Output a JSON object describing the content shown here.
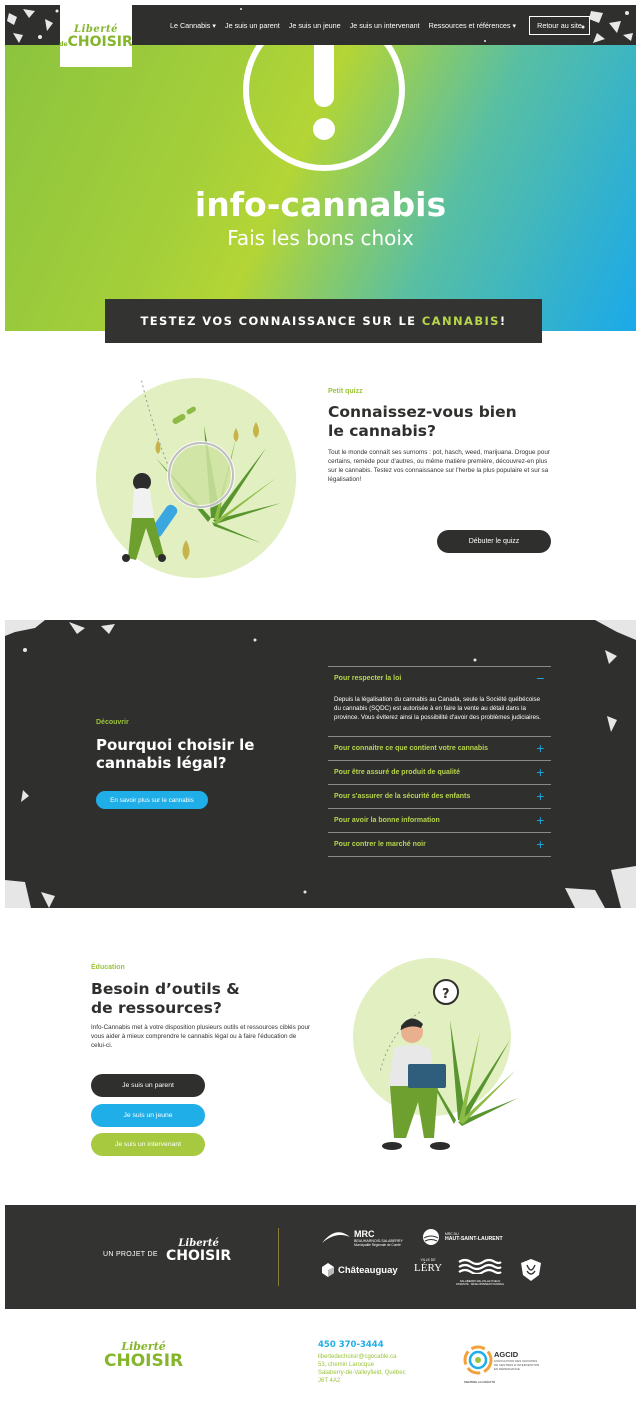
{
  "header": {
    "logo_top": "Liberté",
    "logo_bottom": "CHOISIR",
    "logo_de": "de",
    "nav": [
      {
        "label": "Le Cannabis",
        "has_dropdown": true
      },
      {
        "label": "Je suis un parent",
        "has_dropdown": false
      },
      {
        "label": "Je suis un jeune",
        "has_dropdown": false
      },
      {
        "label": "Je suis un intervenant",
        "has_dropdown": false
      },
      {
        "label": "Ressources et références",
        "has_dropdown": true
      }
    ],
    "dropdown_glyph": "▾",
    "back_button": "Retour au site"
  },
  "hero": {
    "title": "info-cannabis",
    "subtitle": "Fais les bons choix",
    "banner_prefix": "TESTEZ VOS CONNAISSANCE SUR LE ",
    "banner_highlight": "CANNABIS",
    "banner_suffix": "!"
  },
  "quiz": {
    "kicker": "Petit quizz",
    "title_line1": "Connaissez-vous bien",
    "title_line2": "le cannabis?",
    "body": "Tout le monde connaît ses surnoms : pot, hasch, weed, marijuana. Drogue pour certains, remède pour d'autres, ou même matière première, découvrez-en plus sur le cannabis. Testez vos connaissance sur l'herbe la plus populaire et sur sa légalisation!",
    "button": "Débuter le quizz"
  },
  "legal": {
    "kicker": "Découvrir",
    "title_line1": "Pourquoi choisir le",
    "title_line2": "cannabis légal?",
    "button": "En savoir plus sur le cannabis",
    "accordion": [
      {
        "label": "Pour respecter la loi",
        "sign": "−",
        "body": "Depuis la légalisation du cannabis au Canada, seule la Société québécoise du cannabis (SQDC) est autorisée à en faire la vente au détail dans la province. Vous éviterez ainsi la possibilité d'avoir des problèmes judiciaires."
      },
      {
        "label": "Pour connaitre ce que contient votre cannabis",
        "sign": "+"
      },
      {
        "label": "Pour être assuré de produit de qualité",
        "sign": "+"
      },
      {
        "label": "Pour s'assurer de la sécurité des enfants",
        "sign": "+"
      },
      {
        "label": "Pour avoir la bonne information",
        "sign": "+"
      },
      {
        "label": "Pour contrer le marché noir",
        "sign": "+"
      }
    ]
  },
  "education": {
    "kicker": "Éducation",
    "title_line1": "Besoin d’outils &",
    "title_line2": "de ressources?",
    "body": "Info-Cannabis met à votre disposition plusieurs outils et ressources ciblés pour vous aider à mieux comprendre le cannabis légal ou à faire l'éducation de celui-ci.",
    "buttons": [
      "Je suis un parent",
      "Je suis un jeune",
      "Je suis un intervenant"
    ]
  },
  "partners": {
    "project_label": "UN PROJET DE",
    "logos": {
      "mrc": "MRC",
      "mrc_sub": "BEAUHARNOIS-SALABERRY",
      "mrc_sub2": "Municipalité Régionale de Comté",
      "hsl_top": "MRC DU",
      "hsl": "HAUT-SAINT-LAURENT",
      "chateauguay": "Châteauguay",
      "lery_top": "VILLE DE",
      "lery": "LÉRY",
      "valleyfield": "SALABERRY-DE-VALLEYFIELD",
      "valleyfield_sub": "DIVERSITÉ · DÉVELOPPEMENT DURABLE"
    }
  },
  "footer": {
    "phone": "450 370-3444",
    "email": "libertedechoisir@cgocable.ca",
    "address1": "53, chemin Larocque",
    "address2": "Salaberry-de-Valleyfield, Québec",
    "postal": "J6T 4A2",
    "agcid_title": "AGCID",
    "agcid_sub1": "ASSOCIATION DES GROUPES",
    "agcid_sub2": "DE CENTRES D'INTERVENTION",
    "agcid_sub3": "EN DÉPENDANCE",
    "agcid_ring": "MEMBRE ACCRÉDITÉ"
  },
  "colors": {
    "accent_green": "#9cc43b",
    "accent_blue": "#1faee8",
    "dark": "#2f302e",
    "circle_bg": "#e1efc1"
  }
}
